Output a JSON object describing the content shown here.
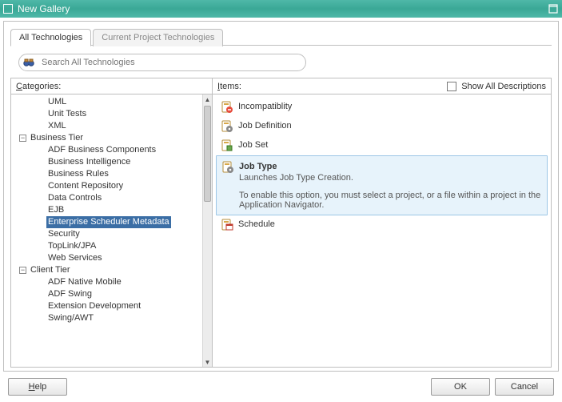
{
  "window": {
    "title": "New Gallery"
  },
  "tabs": {
    "all": "All Technologies",
    "current": "Current Project Technologies"
  },
  "search": {
    "placeholder": "Search All Technologies"
  },
  "labels": {
    "categories": "ategories:",
    "items": "tems:",
    "showAll": "Show All Descriptions"
  },
  "categories": {
    "orphan": [
      "UML",
      "Unit Tests",
      "XML"
    ],
    "groups": [
      {
        "label": "Business Tier",
        "children": [
          "ADF Business Components",
          "Business Intelligence",
          "Business Rules",
          "Content Repository",
          "Data Controls",
          "EJB",
          "Enterprise Scheduler Metadata",
          "Security",
          "TopLink/JPA",
          "Web Services"
        ]
      },
      {
        "label": "Client Tier",
        "children": [
          "ADF Native Mobile",
          "ADF Swing",
          "Extension Development",
          "Swing/AWT"
        ]
      }
    ],
    "selected": "Enterprise Scheduler Metadata"
  },
  "items": [
    {
      "label": "Incompatiblity",
      "icon": "incompat"
    },
    {
      "label": "Job Definition",
      "icon": "jobdef"
    },
    {
      "label": "Job Set",
      "icon": "jobset"
    },
    {
      "label": "Job Type",
      "icon": "jobtype",
      "selected": true,
      "desc": "Launches Job Type Creation.",
      "note": "To enable this option, you must select a project, or a file within a project in the Application Navigator."
    },
    {
      "label": "Schedule",
      "icon": "schedule"
    }
  ],
  "buttons": {
    "help": "elp",
    "ok": "OK",
    "cancel": "Cancel"
  }
}
